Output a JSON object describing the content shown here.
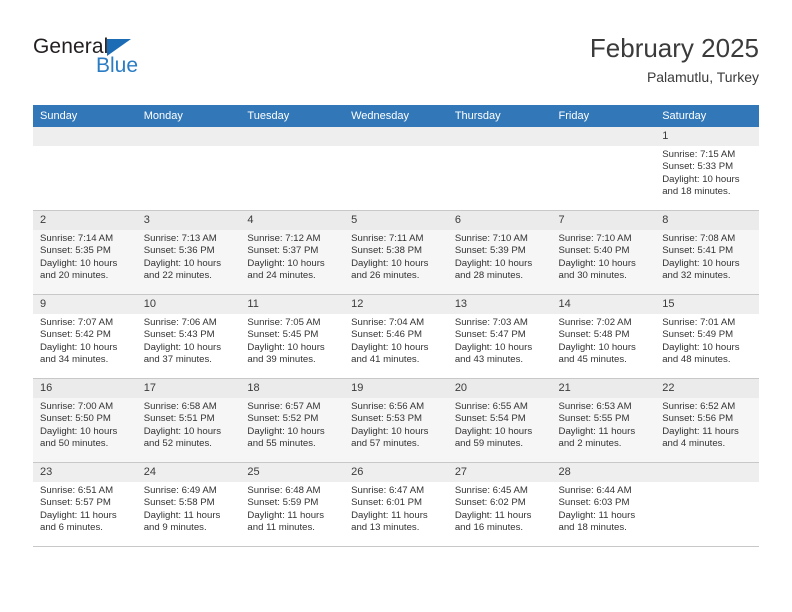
{
  "brand": {
    "name_top": "General",
    "name_bottom": "Blue",
    "triangle_color": "#1c6cb5",
    "blue_color": "#2a7dc4"
  },
  "header": {
    "title": "February 2025",
    "subtitle": "Palamutlu, Turkey"
  },
  "theme": {
    "header_row_bg": "#3278b9",
    "daynum_bg": "#eeeeee",
    "shaded_row_bg": "#f6f6f6",
    "grid_line": "#c8c8c8"
  },
  "weekdays": [
    "Sunday",
    "Monday",
    "Tuesday",
    "Wednesday",
    "Thursday",
    "Friday",
    "Saturday"
  ],
  "labels": {
    "sunrise": "Sunrise:",
    "sunset": "Sunset:",
    "daylight": "Daylight:"
  },
  "weeks": [
    {
      "shaded": false,
      "days": [
        {
          "empty": true,
          "num": ""
        },
        {
          "empty": true,
          "num": ""
        },
        {
          "empty": true,
          "num": ""
        },
        {
          "empty": true,
          "num": ""
        },
        {
          "empty": true,
          "num": ""
        },
        {
          "empty": true,
          "num": ""
        },
        {
          "empty": false,
          "num": "1",
          "sunrise": "Sunrise: 7:15 AM",
          "sunset": "Sunset: 5:33 PM",
          "daylight1": "Daylight: 10 hours",
          "daylight2": "and 18 minutes."
        }
      ]
    },
    {
      "shaded": true,
      "days": [
        {
          "empty": false,
          "num": "2",
          "sunrise": "Sunrise: 7:14 AM",
          "sunset": "Sunset: 5:35 PM",
          "daylight1": "Daylight: 10 hours",
          "daylight2": "and 20 minutes."
        },
        {
          "empty": false,
          "num": "3",
          "sunrise": "Sunrise: 7:13 AM",
          "sunset": "Sunset: 5:36 PM",
          "daylight1": "Daylight: 10 hours",
          "daylight2": "and 22 minutes."
        },
        {
          "empty": false,
          "num": "4",
          "sunrise": "Sunrise: 7:12 AM",
          "sunset": "Sunset: 5:37 PM",
          "daylight1": "Daylight: 10 hours",
          "daylight2": "and 24 minutes."
        },
        {
          "empty": false,
          "num": "5",
          "sunrise": "Sunrise: 7:11 AM",
          "sunset": "Sunset: 5:38 PM",
          "daylight1": "Daylight: 10 hours",
          "daylight2": "and 26 minutes."
        },
        {
          "empty": false,
          "num": "6",
          "sunrise": "Sunrise: 7:10 AM",
          "sunset": "Sunset: 5:39 PM",
          "daylight1": "Daylight: 10 hours",
          "daylight2": "and 28 minutes."
        },
        {
          "empty": false,
          "num": "7",
          "sunrise": "Sunrise: 7:10 AM",
          "sunset": "Sunset: 5:40 PM",
          "daylight1": "Daylight: 10 hours",
          "daylight2": "and 30 minutes."
        },
        {
          "empty": false,
          "num": "8",
          "sunrise": "Sunrise: 7:08 AM",
          "sunset": "Sunset: 5:41 PM",
          "daylight1": "Daylight: 10 hours",
          "daylight2": "and 32 minutes."
        }
      ]
    },
    {
      "shaded": false,
      "days": [
        {
          "empty": false,
          "num": "9",
          "sunrise": "Sunrise: 7:07 AM",
          "sunset": "Sunset: 5:42 PM",
          "daylight1": "Daylight: 10 hours",
          "daylight2": "and 34 minutes."
        },
        {
          "empty": false,
          "num": "10",
          "sunrise": "Sunrise: 7:06 AM",
          "sunset": "Sunset: 5:43 PM",
          "daylight1": "Daylight: 10 hours",
          "daylight2": "and 37 minutes."
        },
        {
          "empty": false,
          "num": "11",
          "sunrise": "Sunrise: 7:05 AM",
          "sunset": "Sunset: 5:45 PM",
          "daylight1": "Daylight: 10 hours",
          "daylight2": "and 39 minutes."
        },
        {
          "empty": false,
          "num": "12",
          "sunrise": "Sunrise: 7:04 AM",
          "sunset": "Sunset: 5:46 PM",
          "daylight1": "Daylight: 10 hours",
          "daylight2": "and 41 minutes."
        },
        {
          "empty": false,
          "num": "13",
          "sunrise": "Sunrise: 7:03 AM",
          "sunset": "Sunset: 5:47 PM",
          "daylight1": "Daylight: 10 hours",
          "daylight2": "and 43 minutes."
        },
        {
          "empty": false,
          "num": "14",
          "sunrise": "Sunrise: 7:02 AM",
          "sunset": "Sunset: 5:48 PM",
          "daylight1": "Daylight: 10 hours",
          "daylight2": "and 45 minutes."
        },
        {
          "empty": false,
          "num": "15",
          "sunrise": "Sunrise: 7:01 AM",
          "sunset": "Sunset: 5:49 PM",
          "daylight1": "Daylight: 10 hours",
          "daylight2": "and 48 minutes."
        }
      ]
    },
    {
      "shaded": true,
      "days": [
        {
          "empty": false,
          "num": "16",
          "sunrise": "Sunrise: 7:00 AM",
          "sunset": "Sunset: 5:50 PM",
          "daylight1": "Daylight: 10 hours",
          "daylight2": "and 50 minutes."
        },
        {
          "empty": false,
          "num": "17",
          "sunrise": "Sunrise: 6:58 AM",
          "sunset": "Sunset: 5:51 PM",
          "daylight1": "Daylight: 10 hours",
          "daylight2": "and 52 minutes."
        },
        {
          "empty": false,
          "num": "18",
          "sunrise": "Sunrise: 6:57 AM",
          "sunset": "Sunset: 5:52 PM",
          "daylight1": "Daylight: 10 hours",
          "daylight2": "and 55 minutes."
        },
        {
          "empty": false,
          "num": "19",
          "sunrise": "Sunrise: 6:56 AM",
          "sunset": "Sunset: 5:53 PM",
          "daylight1": "Daylight: 10 hours",
          "daylight2": "and 57 minutes."
        },
        {
          "empty": false,
          "num": "20",
          "sunrise": "Sunrise: 6:55 AM",
          "sunset": "Sunset: 5:54 PM",
          "daylight1": "Daylight: 10 hours",
          "daylight2": "and 59 minutes."
        },
        {
          "empty": false,
          "num": "21",
          "sunrise": "Sunrise: 6:53 AM",
          "sunset": "Sunset: 5:55 PM",
          "daylight1": "Daylight: 11 hours",
          "daylight2": "and 2 minutes."
        },
        {
          "empty": false,
          "num": "22",
          "sunrise": "Sunrise: 6:52 AM",
          "sunset": "Sunset: 5:56 PM",
          "daylight1": "Daylight: 11 hours",
          "daylight2": "and 4 minutes."
        }
      ]
    },
    {
      "shaded": false,
      "days": [
        {
          "empty": false,
          "num": "23",
          "sunrise": "Sunrise: 6:51 AM",
          "sunset": "Sunset: 5:57 PM",
          "daylight1": "Daylight: 11 hours",
          "daylight2": "and 6 minutes."
        },
        {
          "empty": false,
          "num": "24",
          "sunrise": "Sunrise: 6:49 AM",
          "sunset": "Sunset: 5:58 PM",
          "daylight1": "Daylight: 11 hours",
          "daylight2": "and 9 minutes."
        },
        {
          "empty": false,
          "num": "25",
          "sunrise": "Sunrise: 6:48 AM",
          "sunset": "Sunset: 5:59 PM",
          "daylight1": "Daylight: 11 hours",
          "daylight2": "and 11 minutes."
        },
        {
          "empty": false,
          "num": "26",
          "sunrise": "Sunrise: 6:47 AM",
          "sunset": "Sunset: 6:01 PM",
          "daylight1": "Daylight: 11 hours",
          "daylight2": "and 13 minutes."
        },
        {
          "empty": false,
          "num": "27",
          "sunrise": "Sunrise: 6:45 AM",
          "sunset": "Sunset: 6:02 PM",
          "daylight1": "Daylight: 11 hours",
          "daylight2": "and 16 minutes."
        },
        {
          "empty": false,
          "num": "28",
          "sunrise": "Sunrise: 6:44 AM",
          "sunset": "Sunset: 6:03 PM",
          "daylight1": "Daylight: 11 hours",
          "daylight2": "and 18 minutes."
        },
        {
          "empty": true,
          "num": ""
        }
      ]
    }
  ]
}
